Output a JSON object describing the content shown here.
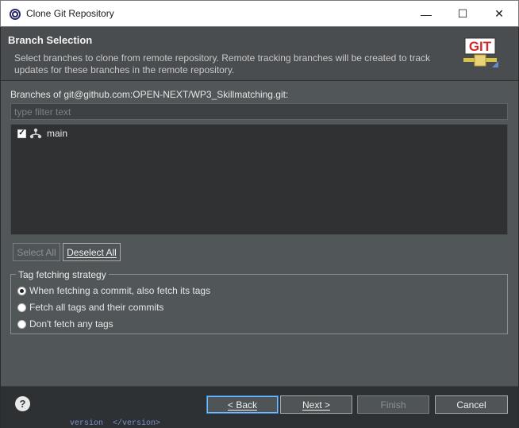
{
  "window": {
    "title": "Clone Git Repository",
    "minimize_glyph": "—",
    "maximize_glyph": "☐",
    "close_glyph": "✕"
  },
  "header": {
    "title": "Branch Selection",
    "description": "Select branches to clone from remote repository. Remote tracking branches will be created to track updates for these branches in the remote repository.",
    "logo_text": "GIT"
  },
  "branches": {
    "label": "Branches of git@github.com:OPEN-NEXT/WP3_Skillmatching.git:",
    "filter_placeholder": "type filter text",
    "items": [
      {
        "name": "main",
        "checked": true
      }
    ]
  },
  "selection_buttons": {
    "select_all": "Select All",
    "deselect_all": "Deselect All"
  },
  "tag_strategy": {
    "legend": "Tag fetching strategy",
    "options": [
      {
        "label": "When fetching a commit, also fetch its tags",
        "selected": true
      },
      {
        "label": "Fetch all tags and their commits",
        "selected": false
      },
      {
        "label": "Don't fetch any tags",
        "selected": false
      }
    ]
  },
  "footer": {
    "help": "?",
    "back": "< Back",
    "next": "Next >",
    "finish": "Finish",
    "cancel": "Cancel"
  },
  "background_text": "version  </version>"
}
